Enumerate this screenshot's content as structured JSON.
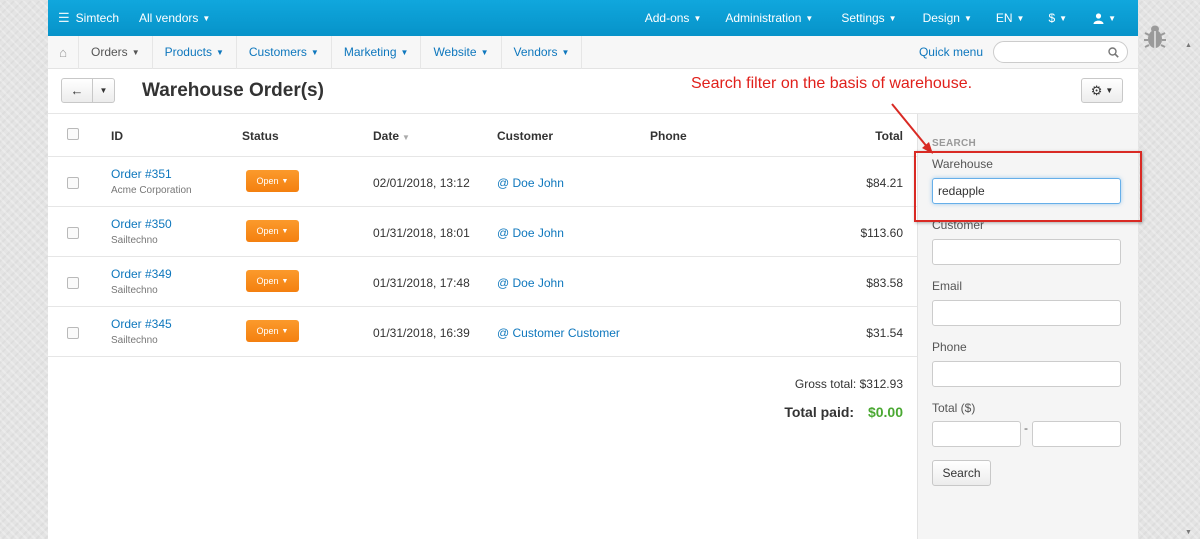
{
  "topbar": {
    "store": "Simtech",
    "vendors": "All vendors",
    "menus": [
      "Add-ons",
      "Administration",
      "Settings",
      "Design",
      "EN",
      "$"
    ]
  },
  "subnav": {
    "items": [
      "Orders",
      "Products",
      "Customers",
      "Marketing",
      "Website",
      "Vendors"
    ],
    "quick_menu": "Quick menu",
    "search_placeholder": ""
  },
  "page": {
    "title": "Warehouse Order(s)",
    "annotation": "Search filter on the basis of warehouse."
  },
  "table": {
    "columns": [
      "ID",
      "Status",
      "Date",
      "Customer",
      "Phone",
      "Total"
    ],
    "rows": [
      {
        "order": "Order #351",
        "company": "Acme Corporation",
        "status": "Open",
        "date": "02/01/2018, 13:12",
        "customer": "@ Doe John",
        "phone": "",
        "total": "$84.21"
      },
      {
        "order": "Order #350",
        "company": "Sailtechno",
        "status": "Open",
        "date": "01/31/2018, 18:01",
        "customer": "@ Doe John",
        "phone": "",
        "total": "$113.60"
      },
      {
        "order": "Order #349",
        "company": "Sailtechno",
        "status": "Open",
        "date": "01/31/2018, 17:48",
        "customer": "@ Doe John",
        "phone": "",
        "total": "$83.58"
      },
      {
        "order": "Order #345",
        "company": "Sailtechno",
        "status": "Open",
        "date": "01/31/2018, 16:39",
        "customer": "@ Customer Customer",
        "phone": "",
        "total": "$31.54"
      }
    ],
    "gross_total_label": "Gross total:",
    "gross_total_value": "$312.93",
    "total_paid_label": "Total paid:",
    "total_paid_value": "$0.00"
  },
  "sidebar": {
    "title": "SEARCH",
    "warehouse_label": "Warehouse",
    "warehouse_value": "redapple",
    "customer_label": "Customer",
    "customer_value": "",
    "email_label": "Email",
    "email_value": "",
    "phone_label": "Phone",
    "phone_value": "",
    "total_label": "Total ($)",
    "total_from": "",
    "total_to": "",
    "range_separator": "-",
    "search_button": "Search"
  },
  "colors": {
    "topbar": "#0a9ed6",
    "link": "#0e77bd",
    "status_open": "#f68a1d",
    "annotation": "#e0201b",
    "paid": "#4aa832"
  },
  "icons": [
    "menu-icon",
    "home-icon",
    "search-icon",
    "back-arrow-icon",
    "gear-icon",
    "user-icon",
    "bug-icon"
  ]
}
